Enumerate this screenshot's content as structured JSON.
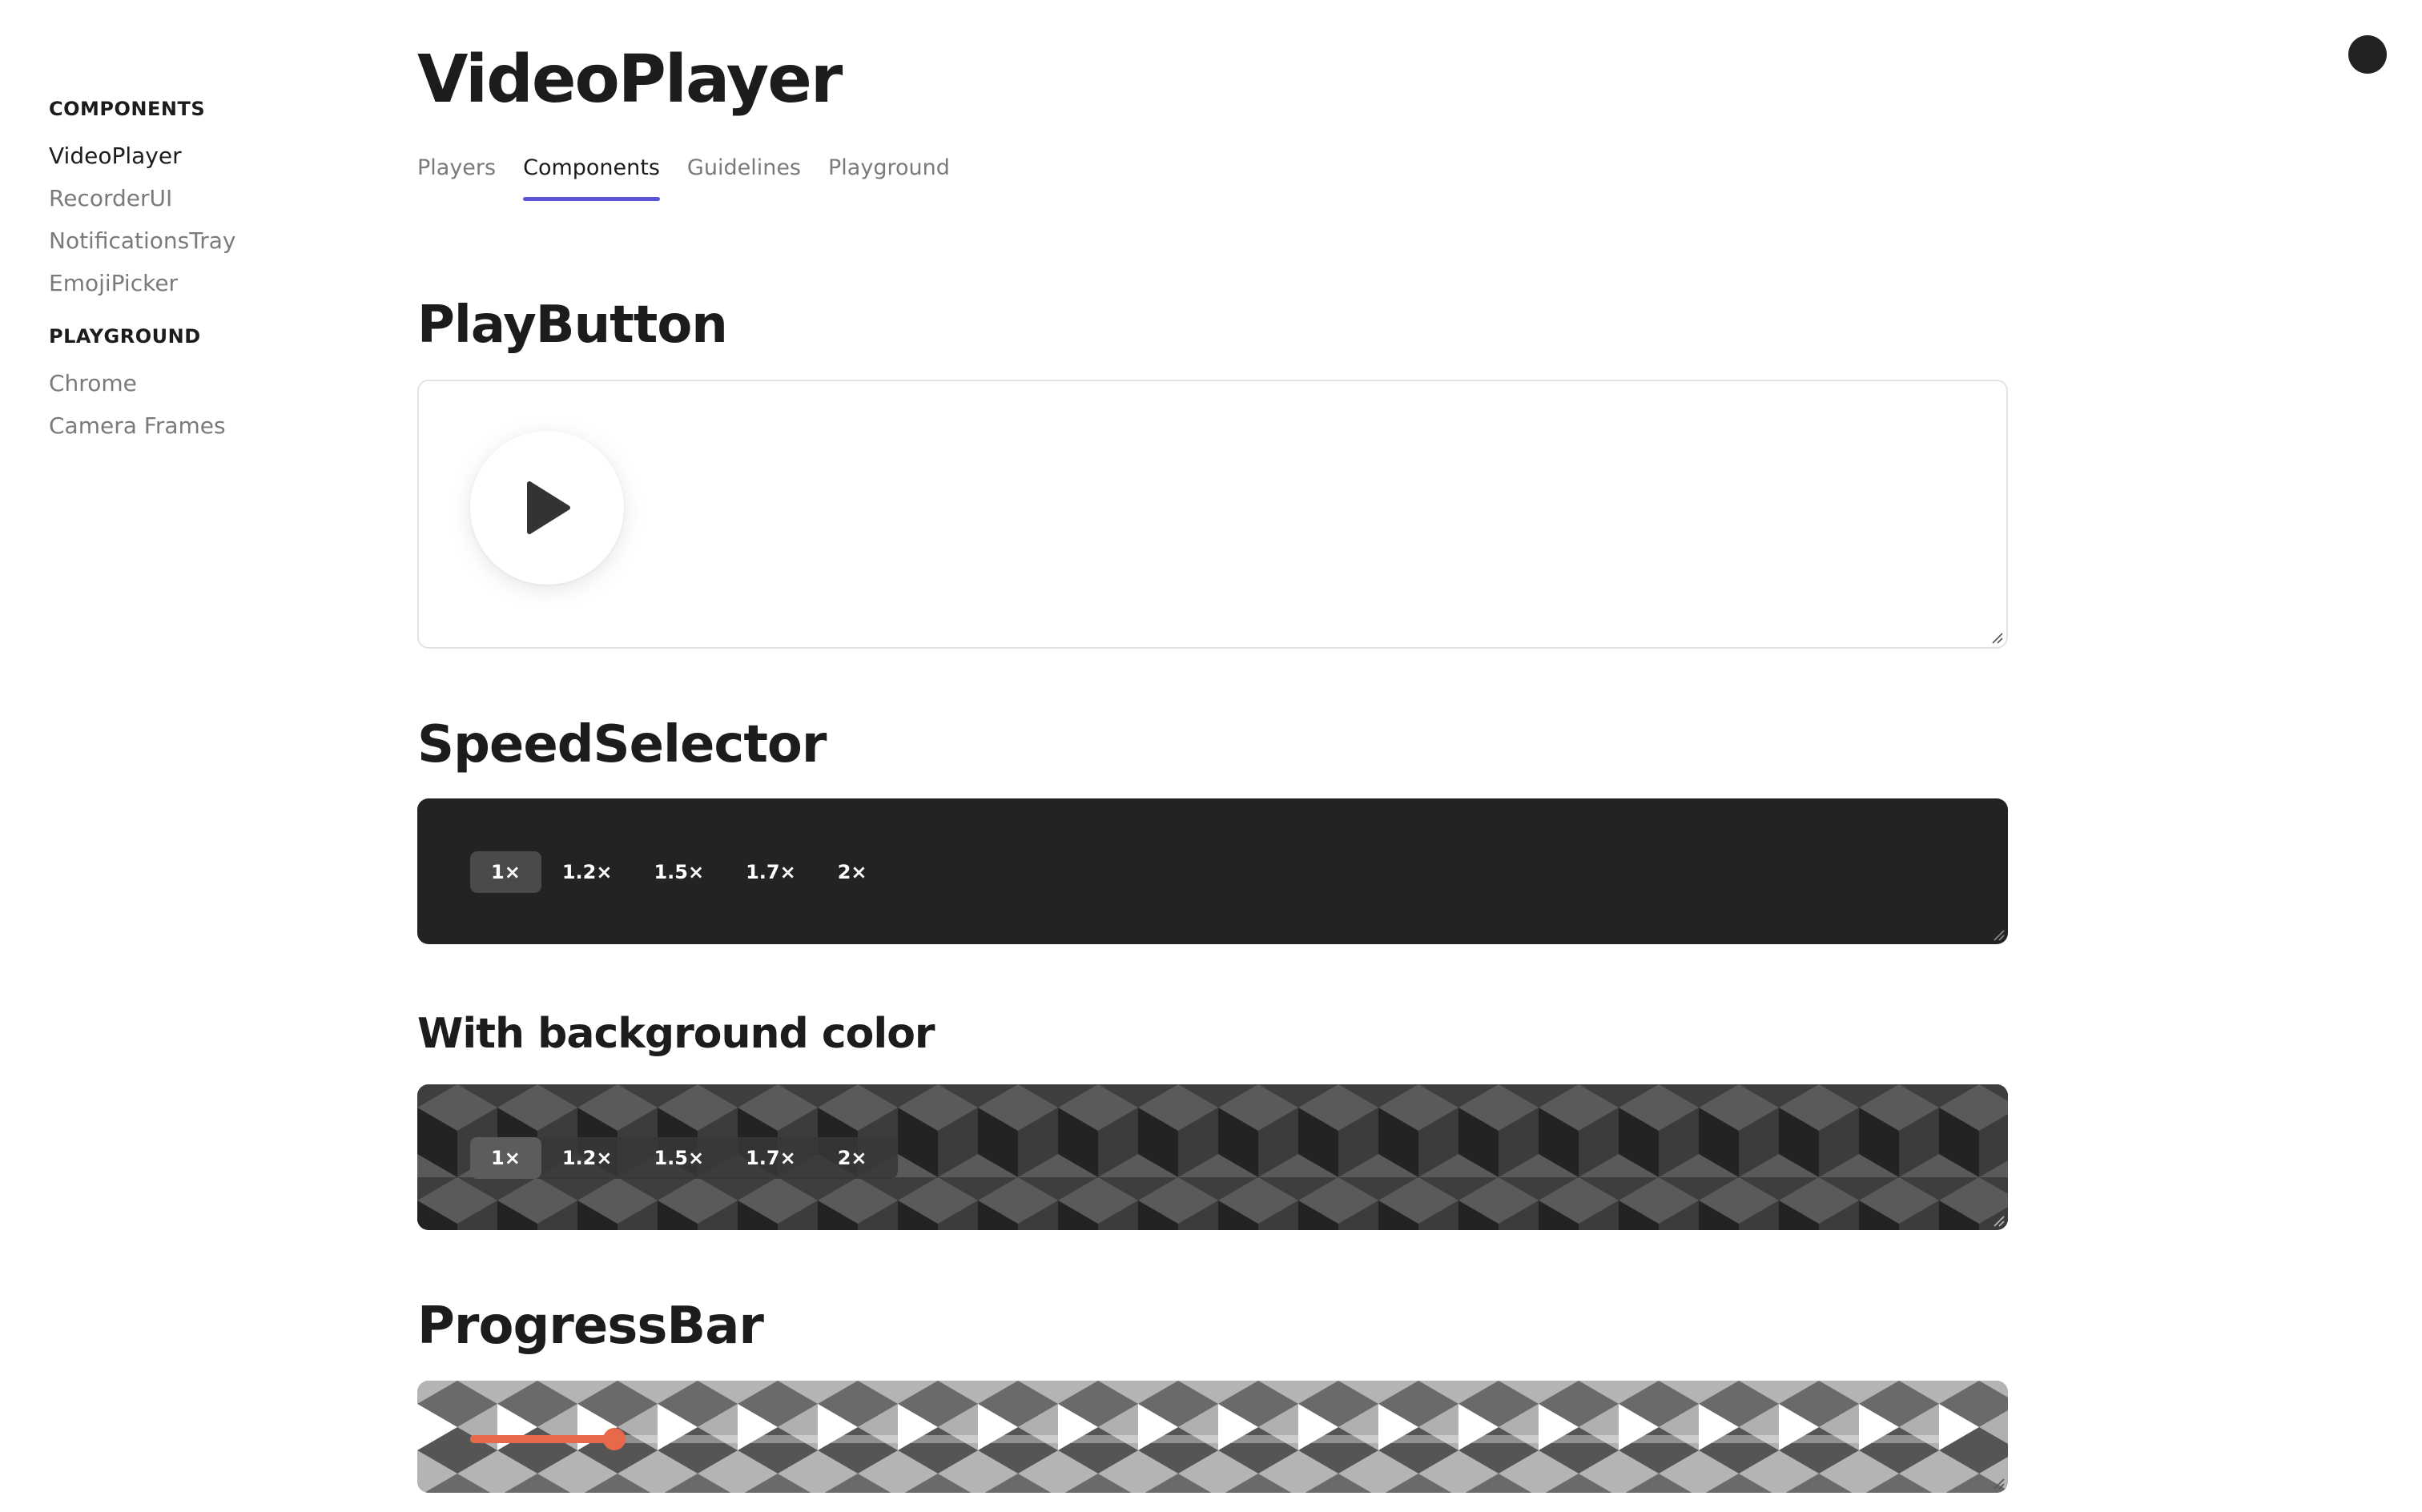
{
  "sidebar": {
    "groups": [
      {
        "heading": "COMPONENTS",
        "items": [
          {
            "label": "VideoPlayer",
            "active": true
          },
          {
            "label": "RecorderUI",
            "active": false
          },
          {
            "label": "NotificationsTray",
            "active": false
          },
          {
            "label": "EmojiPicker",
            "active": false
          }
        ]
      },
      {
        "heading": "PLAYGROUND",
        "items": [
          {
            "label": "Chrome",
            "active": false
          },
          {
            "label": "Camera Frames",
            "active": false
          }
        ]
      }
    ]
  },
  "page": {
    "title": "VideoPlayer",
    "tabs": [
      {
        "label": "Players",
        "active": false
      },
      {
        "label": "Components",
        "active": true
      },
      {
        "label": "Guidelines",
        "active": false
      },
      {
        "label": "Playground",
        "active": false
      }
    ]
  },
  "sections": {
    "play_button": {
      "title": "PlayButton"
    },
    "speed_selector": {
      "title": "SpeedSelector"
    },
    "with_background": {
      "title": "With background color"
    },
    "progress_bar": {
      "title": "ProgressBar"
    }
  },
  "speed_options": [
    {
      "label": "1×",
      "selected": true
    },
    {
      "label": "1.2×",
      "selected": false
    },
    {
      "label": "1.5×",
      "selected": false
    },
    {
      "label": "1.7×",
      "selected": false
    },
    {
      "label": "2×",
      "selected": false
    }
  ],
  "progress": {
    "value": 0.097
  },
  "colors": {
    "accent_tab_underline": "#5a55d6",
    "progress_accent": "#e8684a",
    "dark_surface": "#232323"
  },
  "icons": {
    "play": "play-icon",
    "profile": "profile-dot-icon"
  }
}
